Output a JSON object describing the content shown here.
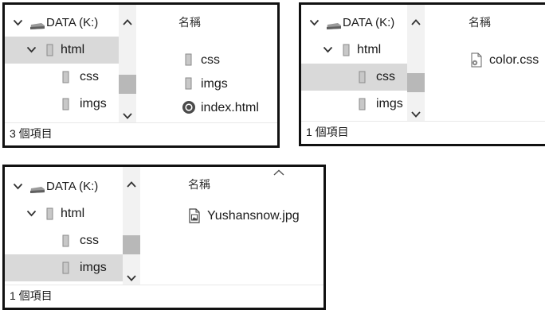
{
  "panels": [
    {
      "tree": [
        "DATA (K:)",
        "html",
        "css",
        "imgs"
      ],
      "column_header": "名稱",
      "files": [
        "css",
        "imgs",
        "index.html"
      ],
      "status": "3 個項目"
    },
    {
      "tree": [
        "DATA (K:)",
        "html",
        "css",
        "imgs"
      ],
      "column_header": "名稱",
      "files": [
        "color.css"
      ],
      "status": "1 個項目"
    },
    {
      "tree": [
        "DATA (K:)",
        "html",
        "css",
        "imgs"
      ],
      "column_header": "名稱",
      "files": [
        "Yushansnow.jpg"
      ],
      "status": "1 個項目"
    }
  ],
  "icons": {
    "drive": "drive-icon",
    "folder": "folder-icon",
    "chrome_file": "chrome-html-icon",
    "css_file": "css-file-icon",
    "image_file": "image-file-icon"
  },
  "colors": {
    "selected_row": "#d9d9d9",
    "scroll_track": "#f2f2f2",
    "scroll_thumb": "#b8b8b8",
    "panel_border": "#111111"
  }
}
